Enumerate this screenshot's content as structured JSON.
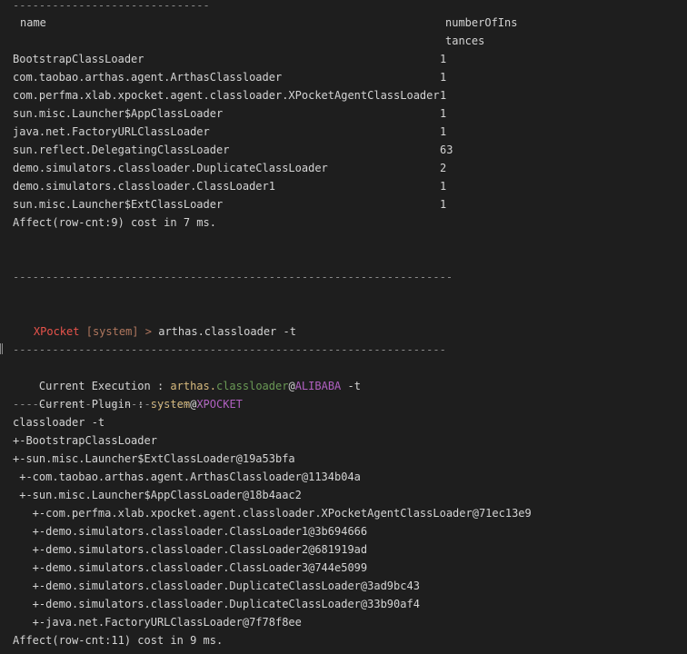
{
  "table": {
    "top_rule": "------------------------------",
    "col_name_header": "name",
    "col_count_header_1": "numberOfIns",
    "col_count_header_2": "tances",
    "rows": [
      {
        "name": "BootstrapClassLoader",
        "count": "1"
      },
      {
        "name": "com.taobao.arthas.agent.ArthasClassloader",
        "count": "1"
      },
      {
        "name": "com.perfma.xlab.xpocket.agent.classloader.XPocketAgentClassLoader",
        "count": "1"
      },
      {
        "name": "sun.misc.Launcher$AppClassLoader",
        "count": "1"
      },
      {
        "name": "java.net.FactoryURLClassLoader",
        "count": "1"
      },
      {
        "name": "sun.reflect.DelegatingClassLoader",
        "count": "63"
      },
      {
        "name": "demo.simulators.classloader.DuplicateClassLoader",
        "count": "2"
      },
      {
        "name": "demo.simulators.classloader.ClassLoader1",
        "count": "1"
      },
      {
        "name": "sun.misc.Launcher$ExtClassLoader",
        "count": "1"
      }
    ],
    "affect": "Affect(row-cnt:9) cost in 7 ms."
  },
  "separator_long": "-------------------------------------------------------------------",
  "prompt": {
    "app": "XPocket",
    "mode": "[system]",
    "arrow": ">",
    "command": "arthas.classloader -t"
  },
  "execution": {
    "separator": "------------------------------------------------------------------",
    "label": "Current Execution : ",
    "tool": "arthas.",
    "plugin": "classloader",
    "at": "@",
    "vendor": "ALIBABA",
    "flag": " -t",
    "plugin_label": "Current Plugin : ",
    "plugin_name": "system",
    "plugin_at": "@",
    "plugin_vendor": "XPOCKET",
    "short_rule": "------------------------------"
  },
  "tree": {
    "command_echo": "classloader -t",
    "lines": [
      "+-BootstrapClassLoader",
      "+-sun.misc.Launcher$ExtClassLoader@19a53bfa",
      " +-com.taobao.arthas.agent.ArthasClassloader@1134b04a",
      " +-sun.misc.Launcher$AppClassLoader@18b4aac2",
      "   +-com.perfma.xlab.xpocket.agent.classloader.XPocketAgentClassLoader@71ec13e9",
      "   +-demo.simulators.classloader.ClassLoader1@3b694666",
      "   +-demo.simulators.classloader.ClassLoader2@681919ad",
      "   +-demo.simulators.classloader.ClassLoader3@744e5099",
      "   +-demo.simulators.classloader.DuplicateClassLoader@3ad9bc43",
      "   +-demo.simulators.classloader.DuplicateClassLoader@33b90af4",
      "   +-java.net.FactoryURLClassLoader@7f78f8ee"
    ],
    "affect": "Affect(row-cnt:11) cost in 9 ms."
  },
  "colors": {
    "background": "#1e1e1e",
    "text": "#d4d4d4",
    "prompt_app": "#e8534b",
    "prompt_mode": "#b0775e",
    "highlight_tool": "#d7ba7d",
    "highlight_plugin": "#6a9955",
    "vendor": "#b060c0"
  }
}
